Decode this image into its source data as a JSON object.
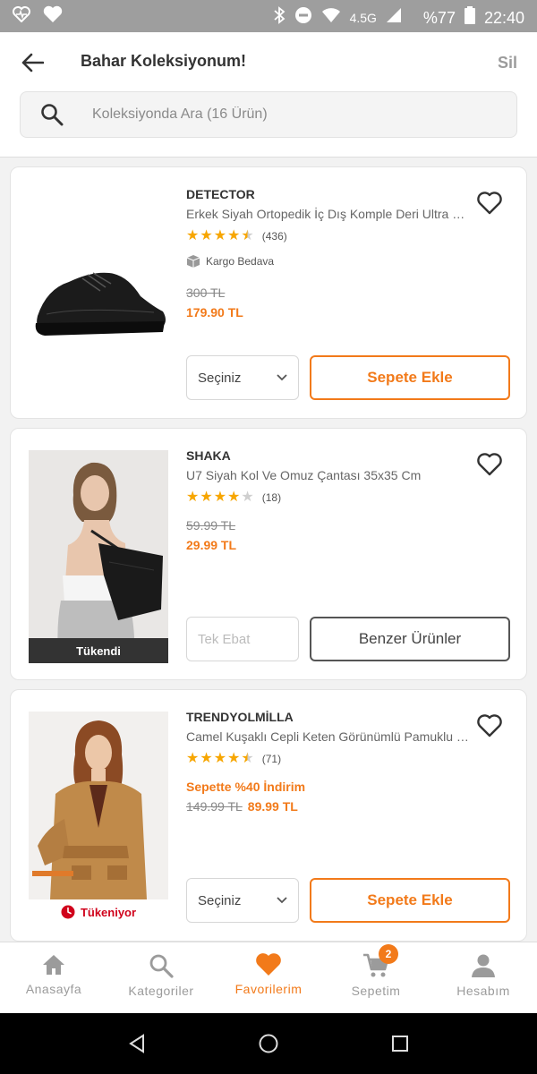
{
  "status_bar": {
    "network": "4.5G",
    "battery": "%77",
    "time": "22:40"
  },
  "header": {
    "title": "Bahar Koleksiyonum!",
    "delete_label": "Sil"
  },
  "search": {
    "placeholder": "Koleksiyonda Ara (16 Ürün)"
  },
  "products": [
    {
      "brand": "DETECTOR",
      "name": "Erkek Siyah Ortopedik İç Dış Komple Deri Ultra R...",
      "rating": 4.5,
      "review_count": "(436)",
      "shipping": "Kargo Bedava",
      "old_price": "300 TL",
      "price": "179.90 TL",
      "variant": "Seçiniz",
      "action": "Sepete Ekle"
    },
    {
      "brand": "SHAKA",
      "name": "U7 Siyah Kol Ve Omuz Çantası 35x35 Cm",
      "rating": 4,
      "review_count": "(18)",
      "old_price": "59.99 TL",
      "price": "29.99 TL",
      "variant": "Tek Ebat",
      "action": "Benzer Ürünler",
      "image_badge": "Tükendi"
    },
    {
      "brand": "TRENDYOLMİLLA",
      "name": "Camel Kuşaklı Cepli Keten Görünümlü Pamuklu C...",
      "rating": 4.5,
      "review_count": "(71)",
      "promo": "Sepette %40 İndirim",
      "old_price": "149.99 TL",
      "price": "89.99 TL",
      "variant": "Seçiniz",
      "action": "Sepete Ekle",
      "image_badge": "Tükeniyor"
    }
  ],
  "bottom_nav": {
    "items": [
      {
        "label": "Anasayfa",
        "icon": "home-icon"
      },
      {
        "label": "Kategoriler",
        "icon": "search-icon"
      },
      {
        "label": "Favorilerim",
        "icon": "heart-icon"
      },
      {
        "label": "Sepetim",
        "icon": "cart-icon"
      },
      {
        "label": "Hesabım",
        "icon": "user-icon"
      }
    ],
    "active_index": 2,
    "cart_count": "2"
  },
  "colors": {
    "accent": "#f27a1a",
    "star": "#f7a600",
    "status_bar": "#9e9e9e"
  }
}
